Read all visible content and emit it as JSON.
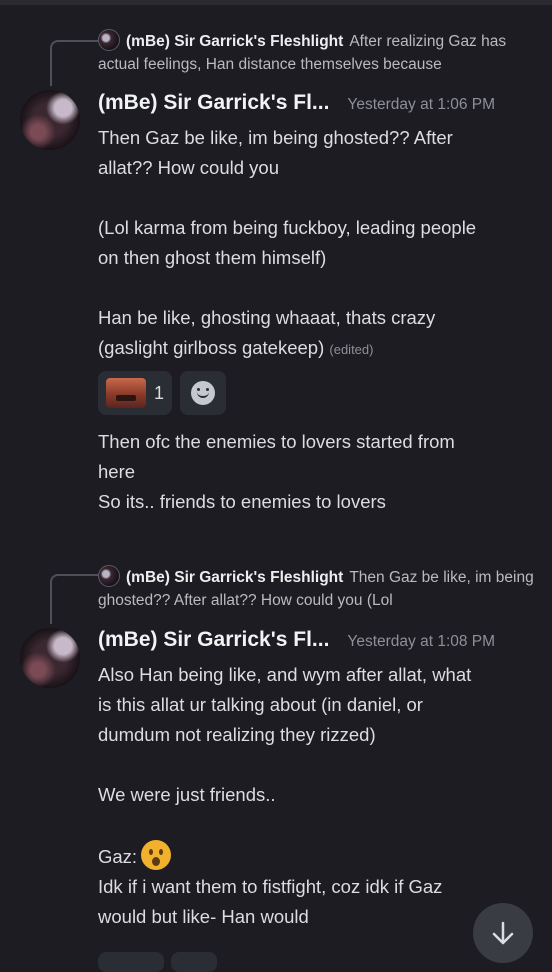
{
  "messages": [
    {
      "reply": {
        "author": "(mBe) Sir Garrick's Fleshlight",
        "snippet": "After realizing Gaz has actual feelings, Han distance themselves because"
      },
      "author": "(mBe) Sir Garrick's Fl...",
      "timestamp": "Yesterday at 1:06 PM",
      "lines": [
        "Then Gaz be like, im being ghosted?? After",
        "allat?? How could you",
        "",
        "(Lol karma from being fuckboy, leading people",
        "on then ghost them himself)",
        "",
        "Han be like, ghosting whaaat, thats crazy",
        "(gaslight girlboss gatekeep)"
      ],
      "edited_label": "(edited)",
      "reaction_count": "1",
      "followups": [
        "Then ofc the enemies to lovers started from",
        "here",
        "So its.. friends to enemies to lovers"
      ]
    },
    {
      "reply": {
        "author": "(mBe) Sir Garrick's Fleshlight",
        "snippet": "Then Gaz be like, im being ghosted?? After allat?? How could you  (Lol"
      },
      "author": "(mBe) Sir Garrick's Fl...",
      "timestamp": "Yesterday at 1:08 PM",
      "lines": [
        "Also Han being like, and wym after allat, what",
        "is this allat ur talking about (in daniel, or",
        "dumdum not realizing they rizzed)",
        "",
        "We were just friends..",
        "",
        "Gaz:",
        "Idk if i want them to fistfight, coz idk if Gaz",
        "would but like- Han would"
      ]
    }
  ],
  "icons": {
    "add_reaction": "smile-plus-icon",
    "scroll_down": "arrow-down-icon",
    "gaz_emoji": "surprised-face-emoji"
  },
  "colors": {
    "background": "#1c1c22",
    "text": "#dcdde0",
    "muted": "#8e9097",
    "reaction_bg": "#2b2d34"
  }
}
